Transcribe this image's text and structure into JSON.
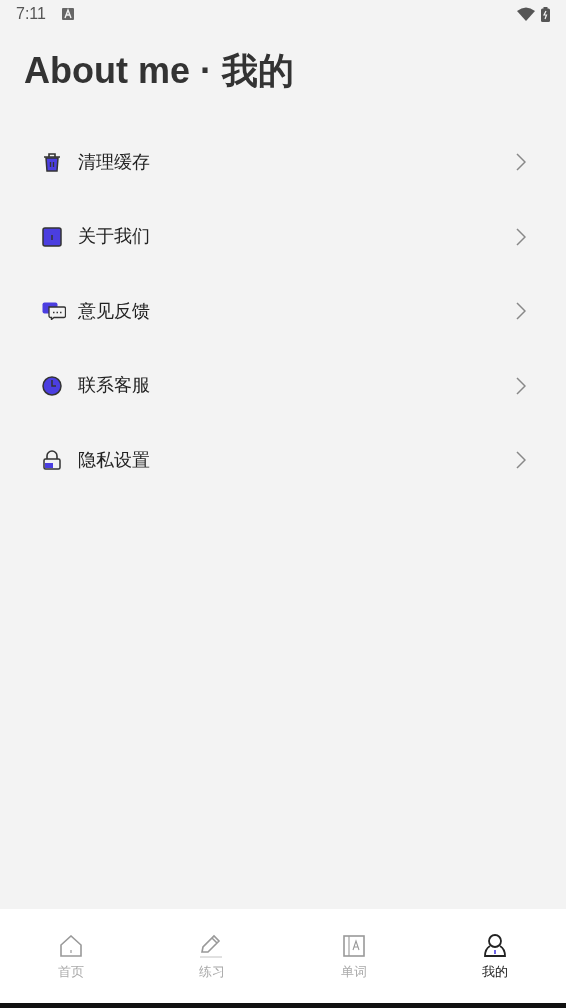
{
  "status_bar": {
    "time": "7:11"
  },
  "title": "About me · 我的",
  "menu": [
    {
      "kind": "trash",
      "label": "清理缓存"
    },
    {
      "kind": "info",
      "label": "关于我们"
    },
    {
      "kind": "chat",
      "label": "意见反馈"
    },
    {
      "kind": "clock",
      "label": "联系客服"
    },
    {
      "kind": "lock",
      "label": "隐私设置"
    }
  ],
  "tabs": [
    {
      "kind": "home",
      "label": "首页",
      "selected": false
    },
    {
      "kind": "pencil",
      "label": "练习",
      "selected": false
    },
    {
      "kind": "book",
      "label": "单词",
      "selected": false
    },
    {
      "kind": "user",
      "label": "我的",
      "selected": true
    }
  ]
}
